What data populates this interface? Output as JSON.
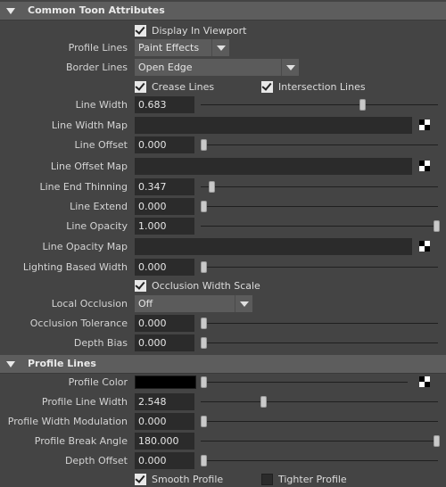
{
  "sections": {
    "toon": {
      "title": "Common Toon Attributes"
    },
    "profile": {
      "title": "Profile Lines"
    }
  },
  "display_in_viewport": {
    "label": "Display In Viewport",
    "checked": true
  },
  "profile_lines": {
    "label": "Profile Lines",
    "value": "Paint Effects"
  },
  "border_lines": {
    "label": "Border Lines",
    "value": "Open Edge"
  },
  "crease_lines": {
    "label": "Crease Lines",
    "checked": true
  },
  "intersection_lines": {
    "label": "Intersection Lines",
    "checked": true
  },
  "line_width": {
    "label": "Line Width",
    "value": "0.683",
    "slider_fraction": 0.683
  },
  "line_width_map": {
    "label": "Line Width Map"
  },
  "line_offset": {
    "label": "Line Offset",
    "value": "0.000",
    "slider_fraction": 0.0
  },
  "line_offset_map": {
    "label": "Line Offset Map"
  },
  "line_end_thinning": {
    "label": "Line End Thinning",
    "value": "0.347",
    "slider_fraction": 0.035
  },
  "line_extend": {
    "label": "Line Extend",
    "value": "0.000",
    "slider_fraction": 0.0
  },
  "line_opacity": {
    "label": "Line Opacity",
    "value": "1.000",
    "slider_fraction": 1.0
  },
  "line_opacity_map": {
    "label": "Line Opacity Map"
  },
  "lighting_based_width": {
    "label": "Lighting Based Width",
    "value": "0.000",
    "slider_fraction": 0.0
  },
  "occlusion_width_scale": {
    "label": "Occlusion Width Scale",
    "checked": true
  },
  "local_occlusion": {
    "label": "Local Occlusion",
    "value": "Off"
  },
  "occlusion_tolerance": {
    "label": "Occlusion Tolerance",
    "value": "0.000",
    "slider_fraction": 0.0
  },
  "depth_bias": {
    "label": "Depth Bias",
    "value": "0.000",
    "slider_fraction": 0.0
  },
  "profile_color": {
    "label": "Profile Color",
    "color": "#000000",
    "slider_fraction": 0.0
  },
  "profile_line_width": {
    "label": "Profile Line Width",
    "value": "2.548",
    "slider_fraction": 0.255
  },
  "profile_width_modulation": {
    "label": "Profile Width Modulation",
    "value": "0.000",
    "slider_fraction": 0.0
  },
  "profile_break_angle": {
    "label": "Profile Break Angle",
    "value": "180.000",
    "slider_fraction": 1.0
  },
  "depth_offset": {
    "label": "Depth Offset",
    "value": "0.000",
    "slider_fraction": 0.0
  },
  "smooth_profile": {
    "label": "Smooth Profile",
    "checked": true
  },
  "tighter_profile": {
    "label": "Tighter Profile",
    "checked": false
  },
  "icons": {
    "map_button": "checker-icon",
    "collapse": "triangle-down-icon"
  },
  "colors": {
    "panel_bg": "#444444",
    "field_bg": "#2b2b2b",
    "header_bg": "#5d5d5d"
  }
}
